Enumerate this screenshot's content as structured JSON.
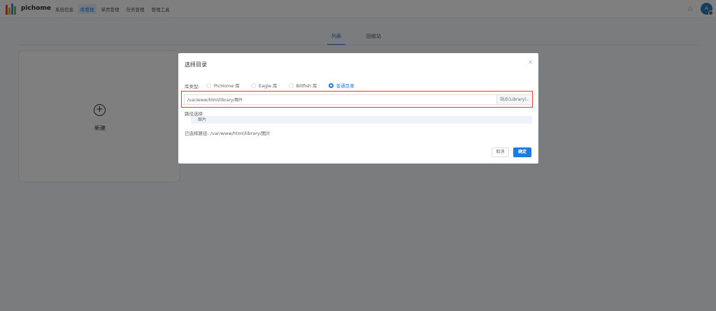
{
  "app": {
    "brand": "pichome"
  },
  "nav": {
    "items": [
      "系统信息",
      "库管理",
      "单页管理",
      "任务管理",
      "管理工具"
    ],
    "active_index": 1
  },
  "user": {
    "avatar_letter": "A"
  },
  "tabs": [
    "列表",
    "回收站"
  ],
  "new_card": {
    "label": "新建"
  },
  "dialog": {
    "title": "选择目录",
    "library_type_label": "库类型:",
    "options": [
      "PicHome 库",
      "Eagle 库",
      "Billfish 库",
      "普通目录"
    ],
    "selected_option": "普通目录",
    "path_value": "/var/www/html/library/图片",
    "site_select": "站点(Library)",
    "path_select_label": "路径选择",
    "folder": "图片",
    "selected_path_label": "已选择路径:",
    "selected_path_value": "/var/www/html/library/图片",
    "cancel": "取消",
    "confirm": "确定"
  },
  "colors": {
    "accent": "#1e7ae0",
    "highlight": "#e53935"
  }
}
